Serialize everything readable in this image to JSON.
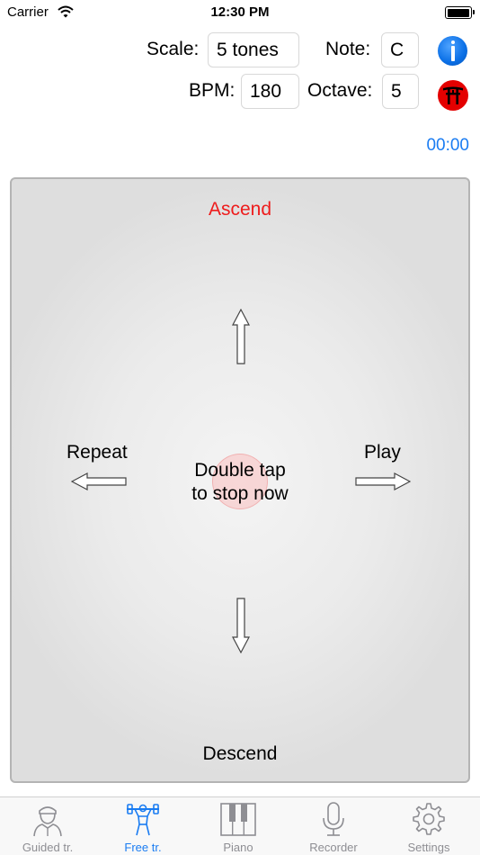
{
  "status_bar": {
    "carrier": "Carrier",
    "time": "12:30 PM"
  },
  "controls": {
    "scale_label": "Scale:",
    "scale_value": "5 tones",
    "note_label": "Note:",
    "note_value": "C",
    "bpm_label": "BPM:",
    "bpm_value": "180",
    "octave_label": "Octave:",
    "octave_value": "5",
    "timer": "00:00"
  },
  "pad": {
    "ascend": "Ascend",
    "descend": "Descend",
    "repeat": "Repeat",
    "play": "Play",
    "center_line1": "Double tap",
    "center_line2": "to stop now"
  },
  "tabs": [
    {
      "label": "Guided tr.",
      "icon": "trainer-icon",
      "active": false
    },
    {
      "label": "Free tr.",
      "icon": "weightlifter-icon",
      "active": true
    },
    {
      "label": "Piano",
      "icon": "piano-keys-icon",
      "active": false
    },
    {
      "label": "Recorder",
      "icon": "microphone-icon",
      "active": false
    },
    {
      "label": "Settings",
      "icon": "gear-icon",
      "active": false
    }
  ],
  "colors": {
    "accent_blue": "#1a7cf2",
    "ascend_red": "#ee1c1c",
    "torii_red": "#e40000",
    "tab_inactive": "#8e8e93"
  }
}
